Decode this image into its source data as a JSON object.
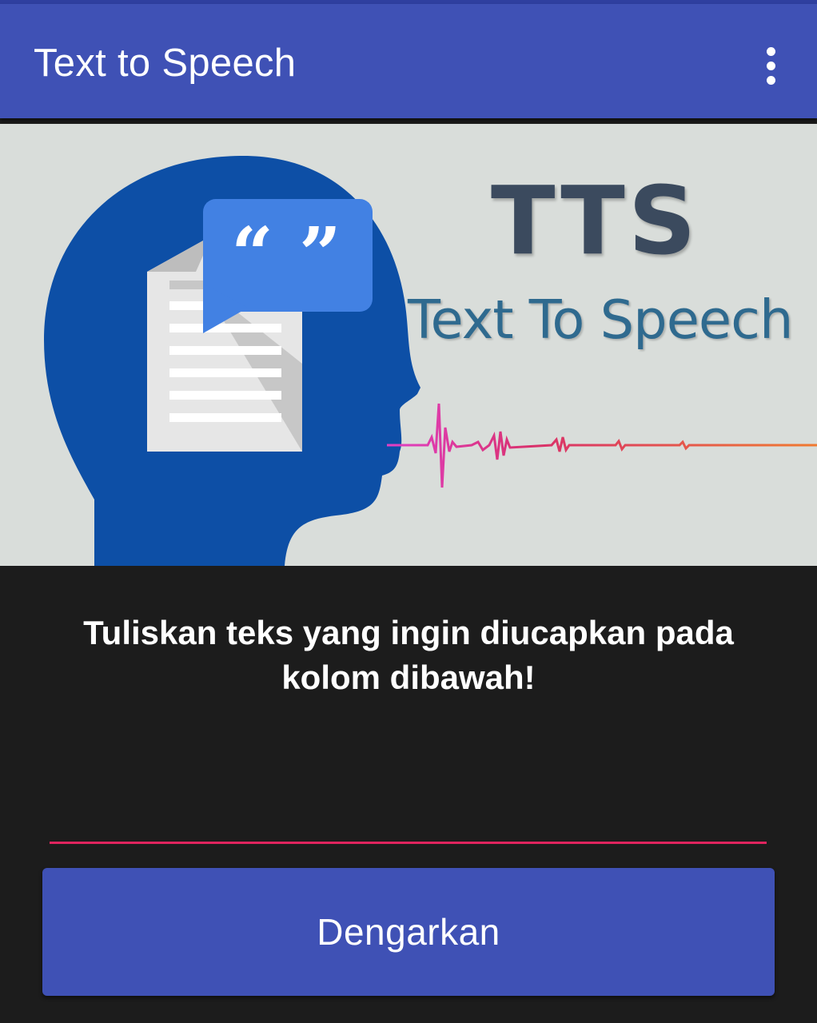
{
  "app_bar": {
    "title": "Text to Speech",
    "overflow_icon": "more-vert-icon"
  },
  "banner": {
    "heading": "TTS",
    "subtitle": "Text To Speech",
    "quote_glyph": "“ ”",
    "icons": [
      "head-silhouette-icon",
      "document-icon",
      "quote-bubble-icon",
      "sound-wave-icon"
    ]
  },
  "main": {
    "instruction": "Tuliskan teks yang ingin diucapkan pada kolom dibawah!",
    "input_value": "",
    "listen_button_label": "Dengarkan"
  },
  "colors": {
    "primary": "#3f51b5",
    "accent": "#e0245e",
    "background": "#1c1c1c",
    "banner_bg": "#d9ddda",
    "head": "#0d4fa6",
    "bubble": "#4281e3"
  }
}
